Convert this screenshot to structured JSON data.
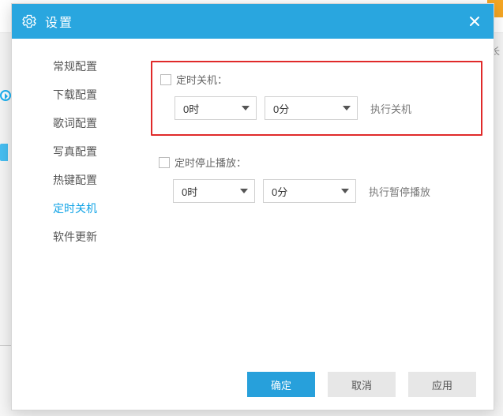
{
  "bg": {
    "truncated_label": "时长"
  },
  "header": {
    "title": "设置"
  },
  "sidebar": {
    "items": [
      {
        "label": "常规配置"
      },
      {
        "label": "下载配置"
      },
      {
        "label": "歌词配置"
      },
      {
        "label": "写真配置"
      },
      {
        "label": "热键配置"
      },
      {
        "label": "定时关机"
      },
      {
        "label": "软件更新"
      }
    ],
    "active_index": 5
  },
  "content": {
    "shutdown": {
      "checkbox_label": "定时关机：",
      "hour_value": "0时",
      "minute_value": "0分",
      "action_label": "执行关机"
    },
    "pause": {
      "checkbox_label": "定时停止播放：",
      "hour_value": "0时",
      "minute_value": "0分",
      "action_label": "执行暂停播放"
    }
  },
  "footer": {
    "ok": "确定",
    "cancel": "取消",
    "apply": "应用"
  }
}
